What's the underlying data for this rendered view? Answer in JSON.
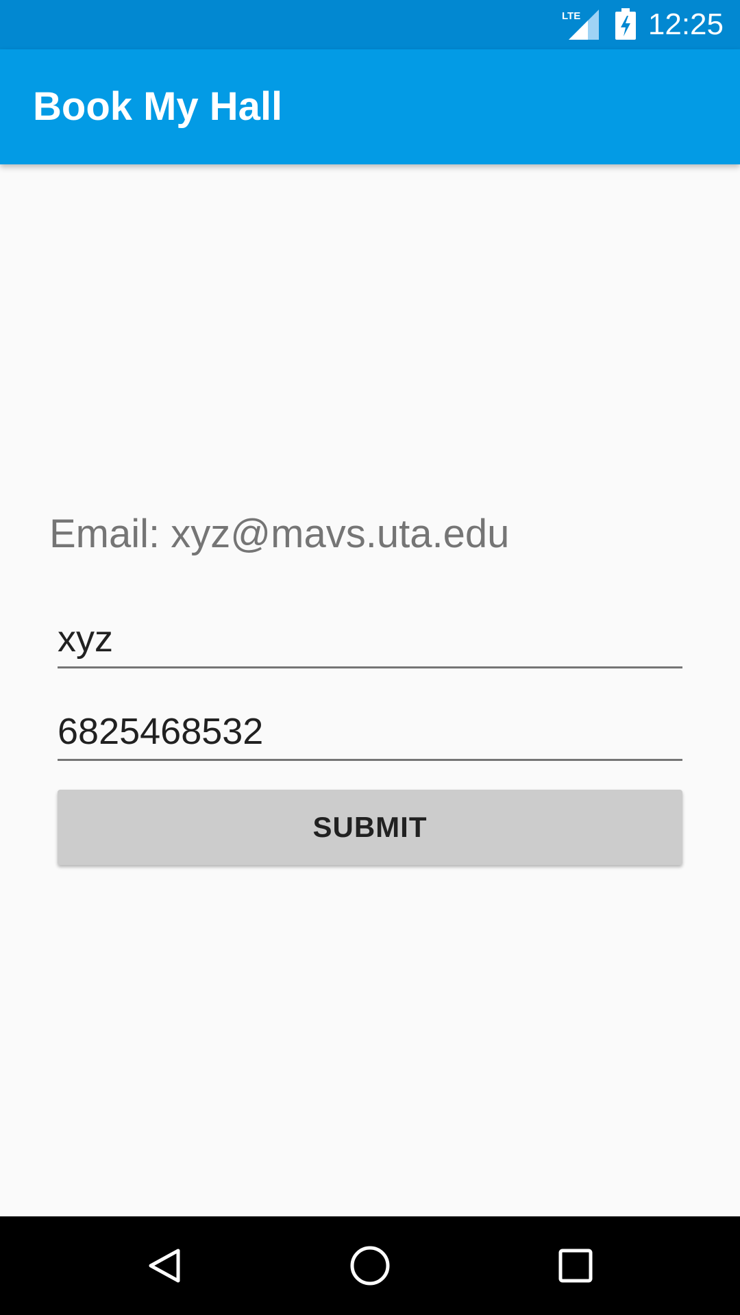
{
  "status_bar": {
    "network_label": "LTE",
    "time": "12:25",
    "signal_icon": "cell-signal-icon",
    "battery_icon": "battery-charging-icon"
  },
  "app_bar": {
    "title": "Book My Hall"
  },
  "form": {
    "email_text": "Email: xyz@mavs.uta.edu",
    "name_value": "xyz",
    "phone_value": "6825468532",
    "submit_label": "SUBMIT"
  },
  "navigation_bar": {
    "back_icon": "back-triangle-icon",
    "home_icon": "home-circle-icon",
    "recents_icon": "recents-square-icon"
  },
  "colors": {
    "status_bar": "#0288d1",
    "app_bar": "#039be5",
    "background": "#fafafa",
    "button": "#cccccc",
    "label_text": "#757575",
    "input_text": "#212121"
  }
}
